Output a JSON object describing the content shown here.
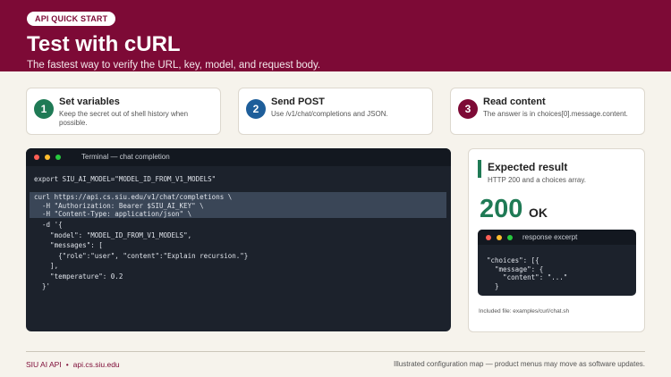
{
  "header": {
    "badge": "API QUICK START",
    "title": "Test with cURL",
    "subtitle": "The fastest way to verify the URL, key, model, and request body."
  },
  "steps": [
    {
      "number": "1",
      "title": "Set variables",
      "description": "Keep the secret out of shell history when possible.",
      "color": "#1f7a55"
    },
    {
      "number": "2",
      "title": "Send POST",
      "description": "Use /v1/chat/completions and JSON.",
      "color": "#1e5e9a"
    },
    {
      "number": "3",
      "title": "Read content",
      "description": "The answer is in choices[0].message.content.",
      "color": "#7d0a36"
    }
  ],
  "terminal": {
    "title": "Terminal — chat completion",
    "lines": [
      "export SIU_AI_MODEL=\"MODEL_ID_FROM_V1_MODELS\"",
      "curl https://api.cs.siu.edu/v1/chat/completions \\",
      "  -H \"Authorization: Bearer $SIU_AI_KEY\" \\",
      "  -H \"Content-Type: application/json\" \\",
      "  -d '{",
      "    \"model\": \"MODEL_ID_FROM_V1_MODELS\",",
      "    \"messages\": [",
      "      {\"role\":\"user\", \"content\":\"Explain recursion.\"}",
      "    ],",
      "    \"temperature\": 0.2",
      "  }'"
    ]
  },
  "result": {
    "title": "Expected result",
    "description": "HTTP 200 and a choices array.",
    "status_code": "200",
    "status_text": "OK",
    "excerpt_title": "response excerpt",
    "excerpt_lines": [
      "\"choices\": [{",
      "  \"message\": {",
      "    \"content\": \"...\"",
      "  }"
    ],
    "included_file": "Included file: examples/curl/chat.sh"
  },
  "footer": {
    "brand": "SIU AI API",
    "separator": "•",
    "domain": "api.cs.siu.edu",
    "note": "Illustrated configuration map — product menus may move as software updates."
  },
  "colors": {
    "brand": "#7d0a36",
    "success": "#1f7a55",
    "info": "#1e5e9a",
    "dot_red": "#ff5f56",
    "dot_yellow": "#ffbd2e",
    "dot_green": "#27c93f"
  }
}
